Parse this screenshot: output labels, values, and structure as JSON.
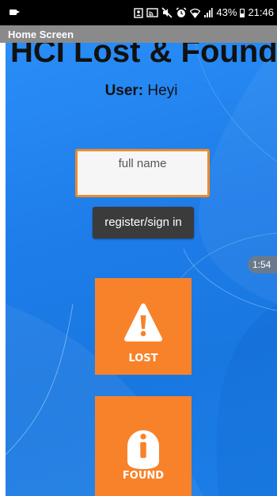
{
  "status_bar": {
    "battery_percent": "43%",
    "time": "21:46",
    "battery_level": 0.43
  },
  "app_bar": {
    "title": "Home Screen"
  },
  "main": {
    "title": "HCI Lost & Found",
    "user_label": "User:",
    "user_name": "Heyi",
    "name_input": {
      "placeholder": "full name",
      "value": ""
    },
    "register_label": "register/sign in",
    "timer_badge": "1:54",
    "lost_button": {
      "label": "LOST",
      "icon": "warning-icon"
    },
    "found_button": {
      "label": "FOUND",
      "icon": "info-icon"
    }
  },
  "colors": {
    "accent_orange": "#f8822a",
    "input_border": "#f08a28",
    "background_blue": "#1e7de9",
    "app_bar_gray": "#8a8a8a",
    "button_dark": "#3b3b3b"
  }
}
